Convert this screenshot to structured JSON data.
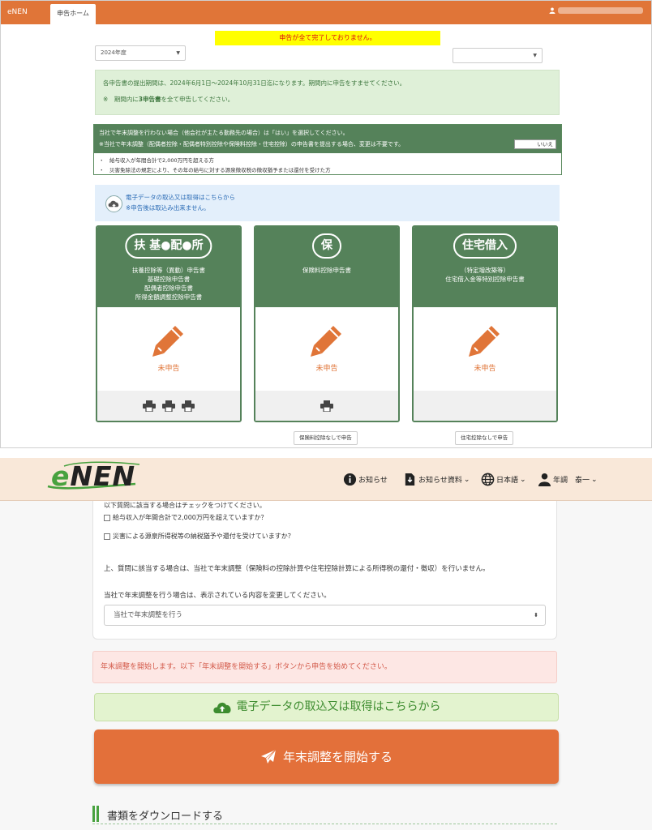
{
  "top": {
    "brand": "eNEN",
    "tab_home": "申告ホーム",
    "warning": "申告が全て完了しておりません。",
    "year_select": "2024年度",
    "period_text": "各申告書の提出期間は、2024年6月1日～2024年10月31日迄になります。期間内に申告をすませてください。",
    "period_note_prefix": "※　期間内に",
    "period_note_bold": "3申告書",
    "period_note_suffix": "を全て申告してください。",
    "yearend": {
      "line1": "当社で年末調整を行わない場合（他会社が主たる勤務先の場合）は「はい」を選択してください。",
      "line2": "※当社で年末調整（配偶者控除・配偶者特別控除や保険料控除・住宅控除）の申告書を提出する場合、変更は不要です。",
      "toggle": "いいえ",
      "item1": "・　給与収入が年間合計で2,000万円を超える方",
      "item2": "・　災害免除法の規定により、その年の給与に対する源泉徴収税の徴収猶予または還付を受けた方"
    },
    "import": {
      "line1": "電子データの取込又は取得はこちらから",
      "line2": "※申告後は取込み出来ません。"
    },
    "cards": [
      {
        "badge": "扶 基●配●所",
        "lines": [
          "扶養控除等（異動）申告書",
          "基礎控除申告書",
          "配偶者控除申告書",
          "所得金額調整控除申告書"
        ],
        "status": "未申告"
      },
      {
        "badge": "保",
        "lines": [
          "保険料控除申告書"
        ],
        "status": "未申告"
      },
      {
        "badge": "住宅借入",
        "lines": [
          "（特定増改築等）",
          "住宅借入金等特別控除申告書"
        ],
        "status": "未申告"
      }
    ],
    "no_insurance_btn": "保険料控除なしで申告",
    "no_housing_btn": "住宅控除なしで申告"
  },
  "bottom": {
    "nav": {
      "notice": "お知らせ",
      "notice_docs": "お知らせ資料",
      "language": "日本語",
      "user": "年調　泰一"
    },
    "question_partial": "以下質問に該当する場合はチェックをつけてください。",
    "check1": "給与収入が年間合計で2,000万円を超えていますか？",
    "check2": "災害による源泉所得税等の納税猶予や還付を受けていますか？",
    "para1": "上、質問に該当する場合は、当社で年末調整（保険料の控除計算や住宅控除計算による所得税の還付・徴収）を行いません。",
    "para2": "当社で年末調整を行う場合は、表示されている内容を変更してください。",
    "select_value": "当社で年末調整を行う",
    "alert": "年末調整を開始します。以下「年末調整を開始する」ボタンから申告を始めてください。",
    "import_button": "電子データの取込又は取得はこちらから",
    "start_button": "年末調整を開始する",
    "download_heading": "書類をダウンロードする"
  },
  "colors": {
    "orange": "#e07538",
    "green": "#55825a",
    "alert_red": "#d35a4a"
  }
}
